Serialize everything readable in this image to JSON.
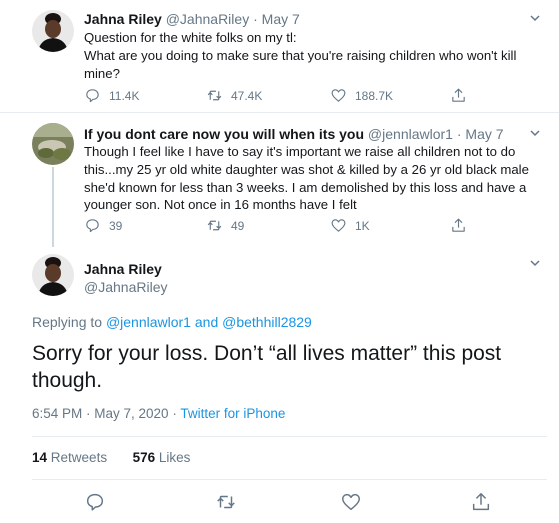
{
  "tweet1": {
    "name": "Jahna Riley",
    "handle": "@JahnaRiley",
    "separator": "·",
    "date": "May 7",
    "text": "Question for the white folks on my tl:\nWhat are you doing to make sure that you're raising children who won't kill mine?",
    "replies": "11.4K",
    "retweets": "47.4K",
    "likes": "188.7K"
  },
  "tweet2": {
    "name": "If you dont care now you will when its you",
    "handle": "@jennlawlor1",
    "separator": "·",
    "date": "May 7",
    "text": "Though I feel like I have to say it's important we raise all children not to do this...my 25 yr old white daughter was shot & killed by a 26 yr old black male she'd known for less than 3 weeks. I am demolished by this loss and have a younger son. Not once in 16 months have I felt",
    "replies": "39",
    "retweets": "49",
    "likes": "1K"
  },
  "main_tweet": {
    "name": "Jahna Riley",
    "handle": "@JahnaRiley",
    "replying_prefix": "Replying to",
    "replying_to_1": "@jennlawlor1",
    "replying_and": "and",
    "replying_to_2": "@bethhill2829",
    "text": "Sorry for your loss. Don’t “all lives matter” this post though.",
    "time": "6:54 PM · May 7, 2020 ·",
    "source": "Twitter for iPhone",
    "retweets_count": "14",
    "retweets_label": "Retweets",
    "likes_count": "576",
    "likes_label": "Likes"
  },
  "icons": {
    "reply": "reply-icon",
    "retweet": "retweet-icon",
    "like": "like-icon",
    "share": "share-icon",
    "caret": "chevron-down-icon"
  },
  "colors": {
    "text": "#14171a",
    "muted": "#657786",
    "link": "#1b95e0",
    "border": "#e6ecf0"
  }
}
